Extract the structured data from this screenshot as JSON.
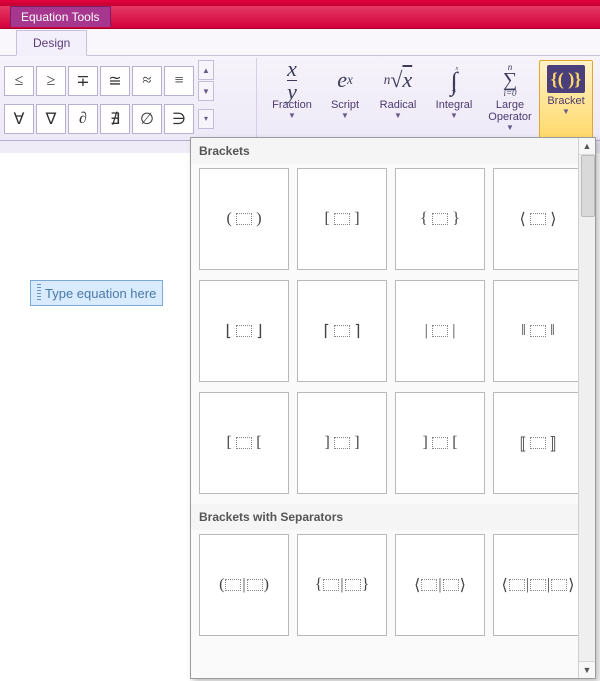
{
  "titleTab": "Equation Tools",
  "ribbonTab": "Design",
  "symbols": {
    "row1": [
      "≤",
      "≥",
      "∓",
      "≅",
      "≈",
      "≡"
    ],
    "row2": [
      "∀",
      "∇",
      "∂",
      "∄",
      "∅",
      "∋"
    ]
  },
  "structures": [
    {
      "key": "fraction",
      "label": "Fraction"
    },
    {
      "key": "script",
      "label": "Script"
    },
    {
      "key": "radical",
      "label": "Radical"
    },
    {
      "key": "integral",
      "label": "Integral"
    },
    {
      "key": "largeop",
      "label": "Large\nOperator"
    },
    {
      "key": "bracket",
      "label": "Bracket"
    }
  ],
  "equationPlaceholder": "Type equation here",
  "gallery": {
    "section1": "Brackets",
    "section2": "Brackets with Separators",
    "items1": [
      "paren",
      "square",
      "curly",
      "angle",
      "floor",
      "ceil",
      "vbar",
      "dblvbar",
      "lsq-lsq",
      "rsq-rsq",
      "rsq-lsq",
      "dblsq"
    ],
    "items2": [
      "paren-sep",
      "curly-sep",
      "angle-sep",
      "angle-sep3"
    ]
  }
}
